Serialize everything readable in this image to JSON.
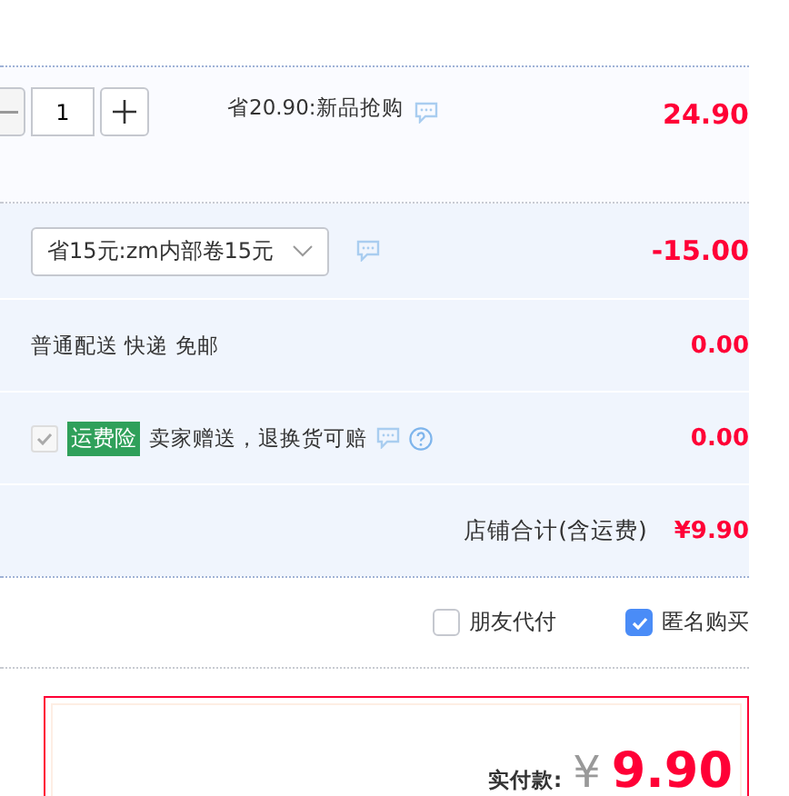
{
  "item": {
    "quantity": "1",
    "promotion": "省20.90:新品抢购",
    "price": "24.90"
  },
  "coupon": {
    "value": "省15元:zm内部卷15元",
    "amount": "-15.00"
  },
  "shipping": {
    "label": "普通配送 快递 免邮",
    "amount": "0.00"
  },
  "insurance": {
    "checked": true,
    "disabled": true,
    "tag": "运费险",
    "label": "卖家赠送，退换货可赔",
    "amount": "0.00"
  },
  "store_total": {
    "label": "店铺合计(含运费)",
    "amount": "¥9.90"
  },
  "options": [
    {
      "label": "朋友代付",
      "checked": false
    },
    {
      "label": "匿名购买",
      "checked": true
    }
  ],
  "payment": {
    "label": "实付款:",
    "currency": "¥",
    "amount": "9.90"
  }
}
